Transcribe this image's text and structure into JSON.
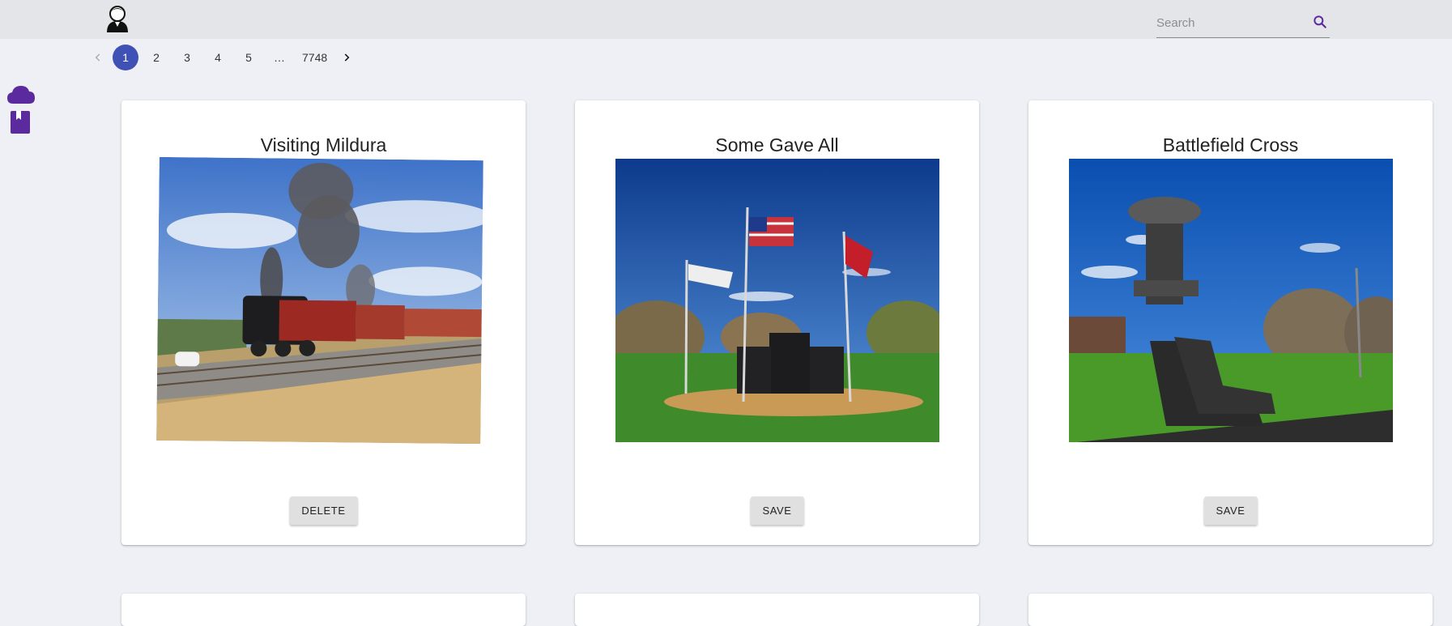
{
  "header": {
    "avatar_icon": "user-avatar-icon",
    "search": {
      "placeholder": "Search",
      "value": "",
      "icon": "search-icon"
    }
  },
  "pagination": {
    "prev_icon": "chevron-left-icon",
    "pages": [
      "1",
      "2",
      "3",
      "4",
      "5"
    ],
    "active_page": "1",
    "ellipsis": "…",
    "last_page": "7748",
    "next_icon": "chevron-right-icon"
  },
  "sidebar": {
    "items": [
      {
        "icon": "cloud-icon"
      },
      {
        "icon": "bookmark-book-icon"
      }
    ]
  },
  "cards": [
    {
      "title": "Visiting Mildura",
      "button_label": "DELETE",
      "image": "steam-train-photo"
    },
    {
      "title": "Some Gave All",
      "button_label": "SAVE",
      "image": "memorial-flags-photo"
    },
    {
      "title": "Battlefield Cross",
      "button_label": "SAVE",
      "image": "battlefield-cross-photo"
    }
  ],
  "colors": {
    "accent": "#3f51b5",
    "icon_purple": "#5b2a9e",
    "background": "#eff0f5",
    "topbar": "#e4e5e8"
  }
}
